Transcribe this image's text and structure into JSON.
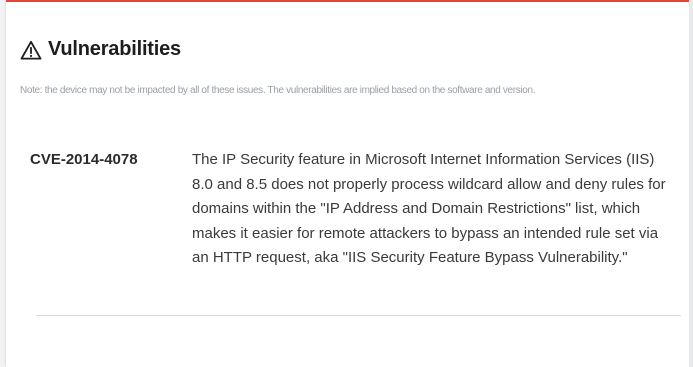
{
  "panel": {
    "title": "Vulnerabilities",
    "icon": "warning-triangle-icon",
    "accent_color": "#e0473a",
    "note": "Note: the device may not be impacted by all of these issues. The vulnerabilities are implied based on the software and version."
  },
  "vulnerabilities": [
    {
      "id": "CVE-2014-4078",
      "description": "The IP Security feature in Microsoft Internet Information Services (IIS) 8.0 and 8.5 does not properly process wildcard allow and deny rules for domains within the \"IP Address and Domain Restrictions\" list, which makes it easier for remote attackers to bypass an intended rule set via an HTTP request, aka \"IIS Security Feature Bypass Vulnerability.\""
    }
  ]
}
